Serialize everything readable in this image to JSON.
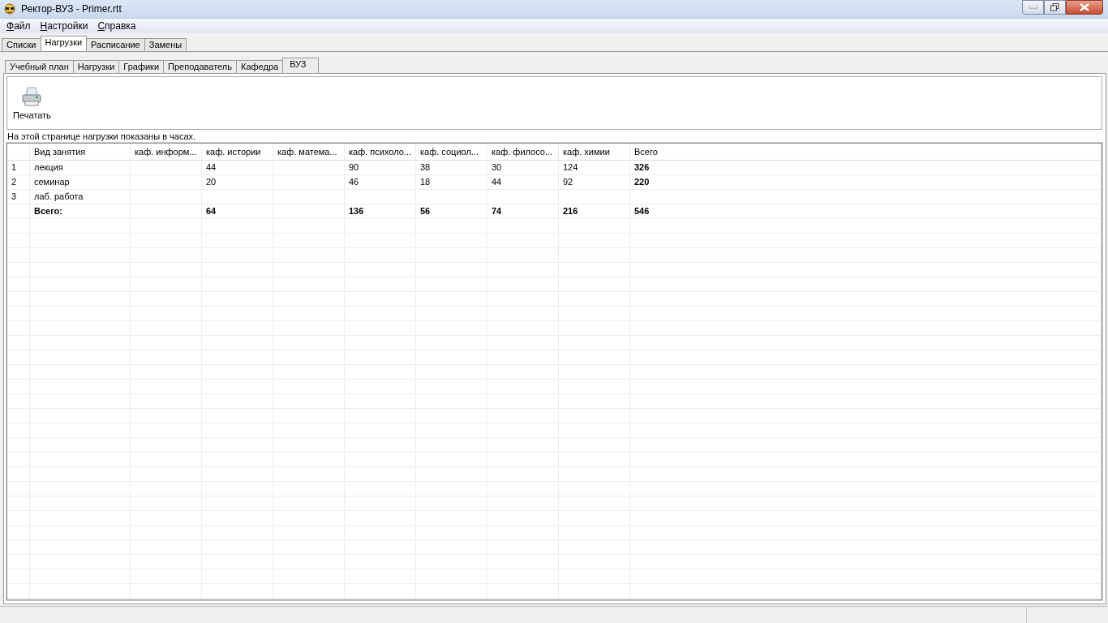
{
  "window": {
    "title": "Ректор-ВУЗ - Primer.rtt"
  },
  "menu": [
    "Файл",
    "Настройки",
    "Справка"
  ],
  "tabs": [
    {
      "label": "Списки",
      "selected": false
    },
    {
      "label": "Нагрузки",
      "selected": true
    },
    {
      "label": "Расписание",
      "selected": false
    },
    {
      "label": "Замены",
      "selected": false
    }
  ],
  "subtabs": [
    {
      "label": "Учебный план",
      "selected": false
    },
    {
      "label": "Нагрузки",
      "selected": false
    },
    {
      "label": "Графики",
      "selected": false
    },
    {
      "label": "Преподаватель",
      "selected": false
    },
    {
      "label": "Кафедра",
      "selected": false
    },
    {
      "label": "ВУЗ",
      "selected": true
    }
  ],
  "toolbar": {
    "print_button": "Печатать"
  },
  "note": "На этой странице нагрузки показаны в часах.",
  "table": {
    "columns": [
      "Вид занятия",
      "каф. информ...",
      "каф. истории",
      "каф. матема...",
      "каф. психоло...",
      "каф. социол...",
      "каф. филосо...",
      "каф. химии",
      "Всего"
    ],
    "rows": [
      {
        "kind": "data",
        "number": "1",
        "cells": [
          "лекция",
          null,
          "44",
          null,
          "90",
          "38",
          "30",
          "124",
          "326"
        ]
      },
      {
        "kind": "data",
        "number": "2",
        "cells": [
          "семинар",
          null,
          "20",
          null,
          "46",
          "18",
          "44",
          "92",
          "220"
        ]
      },
      {
        "kind": "data",
        "number": "3",
        "cells": [
          "лаб. работа",
          null,
          null,
          null,
          null,
          null,
          null,
          null,
          null
        ]
      },
      {
        "kind": "total",
        "cells": [
          "Всего:",
          null,
          "64",
          null,
          "136",
          "56",
          "74",
          "216",
          "546"
        ]
      }
    ]
  }
}
